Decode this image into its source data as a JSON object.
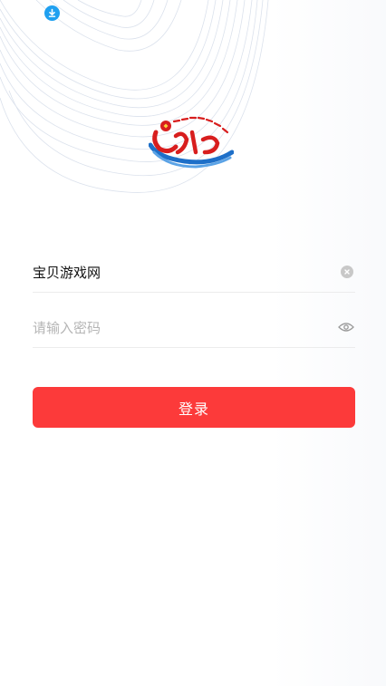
{
  "topbar": {
    "download_icon": "download-icon"
  },
  "logo": {
    "icon": "party-emblem-logo"
  },
  "login_form": {
    "username": {
      "value": "宝贝游戏网",
      "clear_icon": "clear-icon"
    },
    "password": {
      "placeholder": "请输入密码",
      "toggle_icon": "eye-icon"
    },
    "submit_label": "登录"
  },
  "colors": {
    "primary": "#fc3a3a",
    "download_icon": "#1fa0f0"
  }
}
